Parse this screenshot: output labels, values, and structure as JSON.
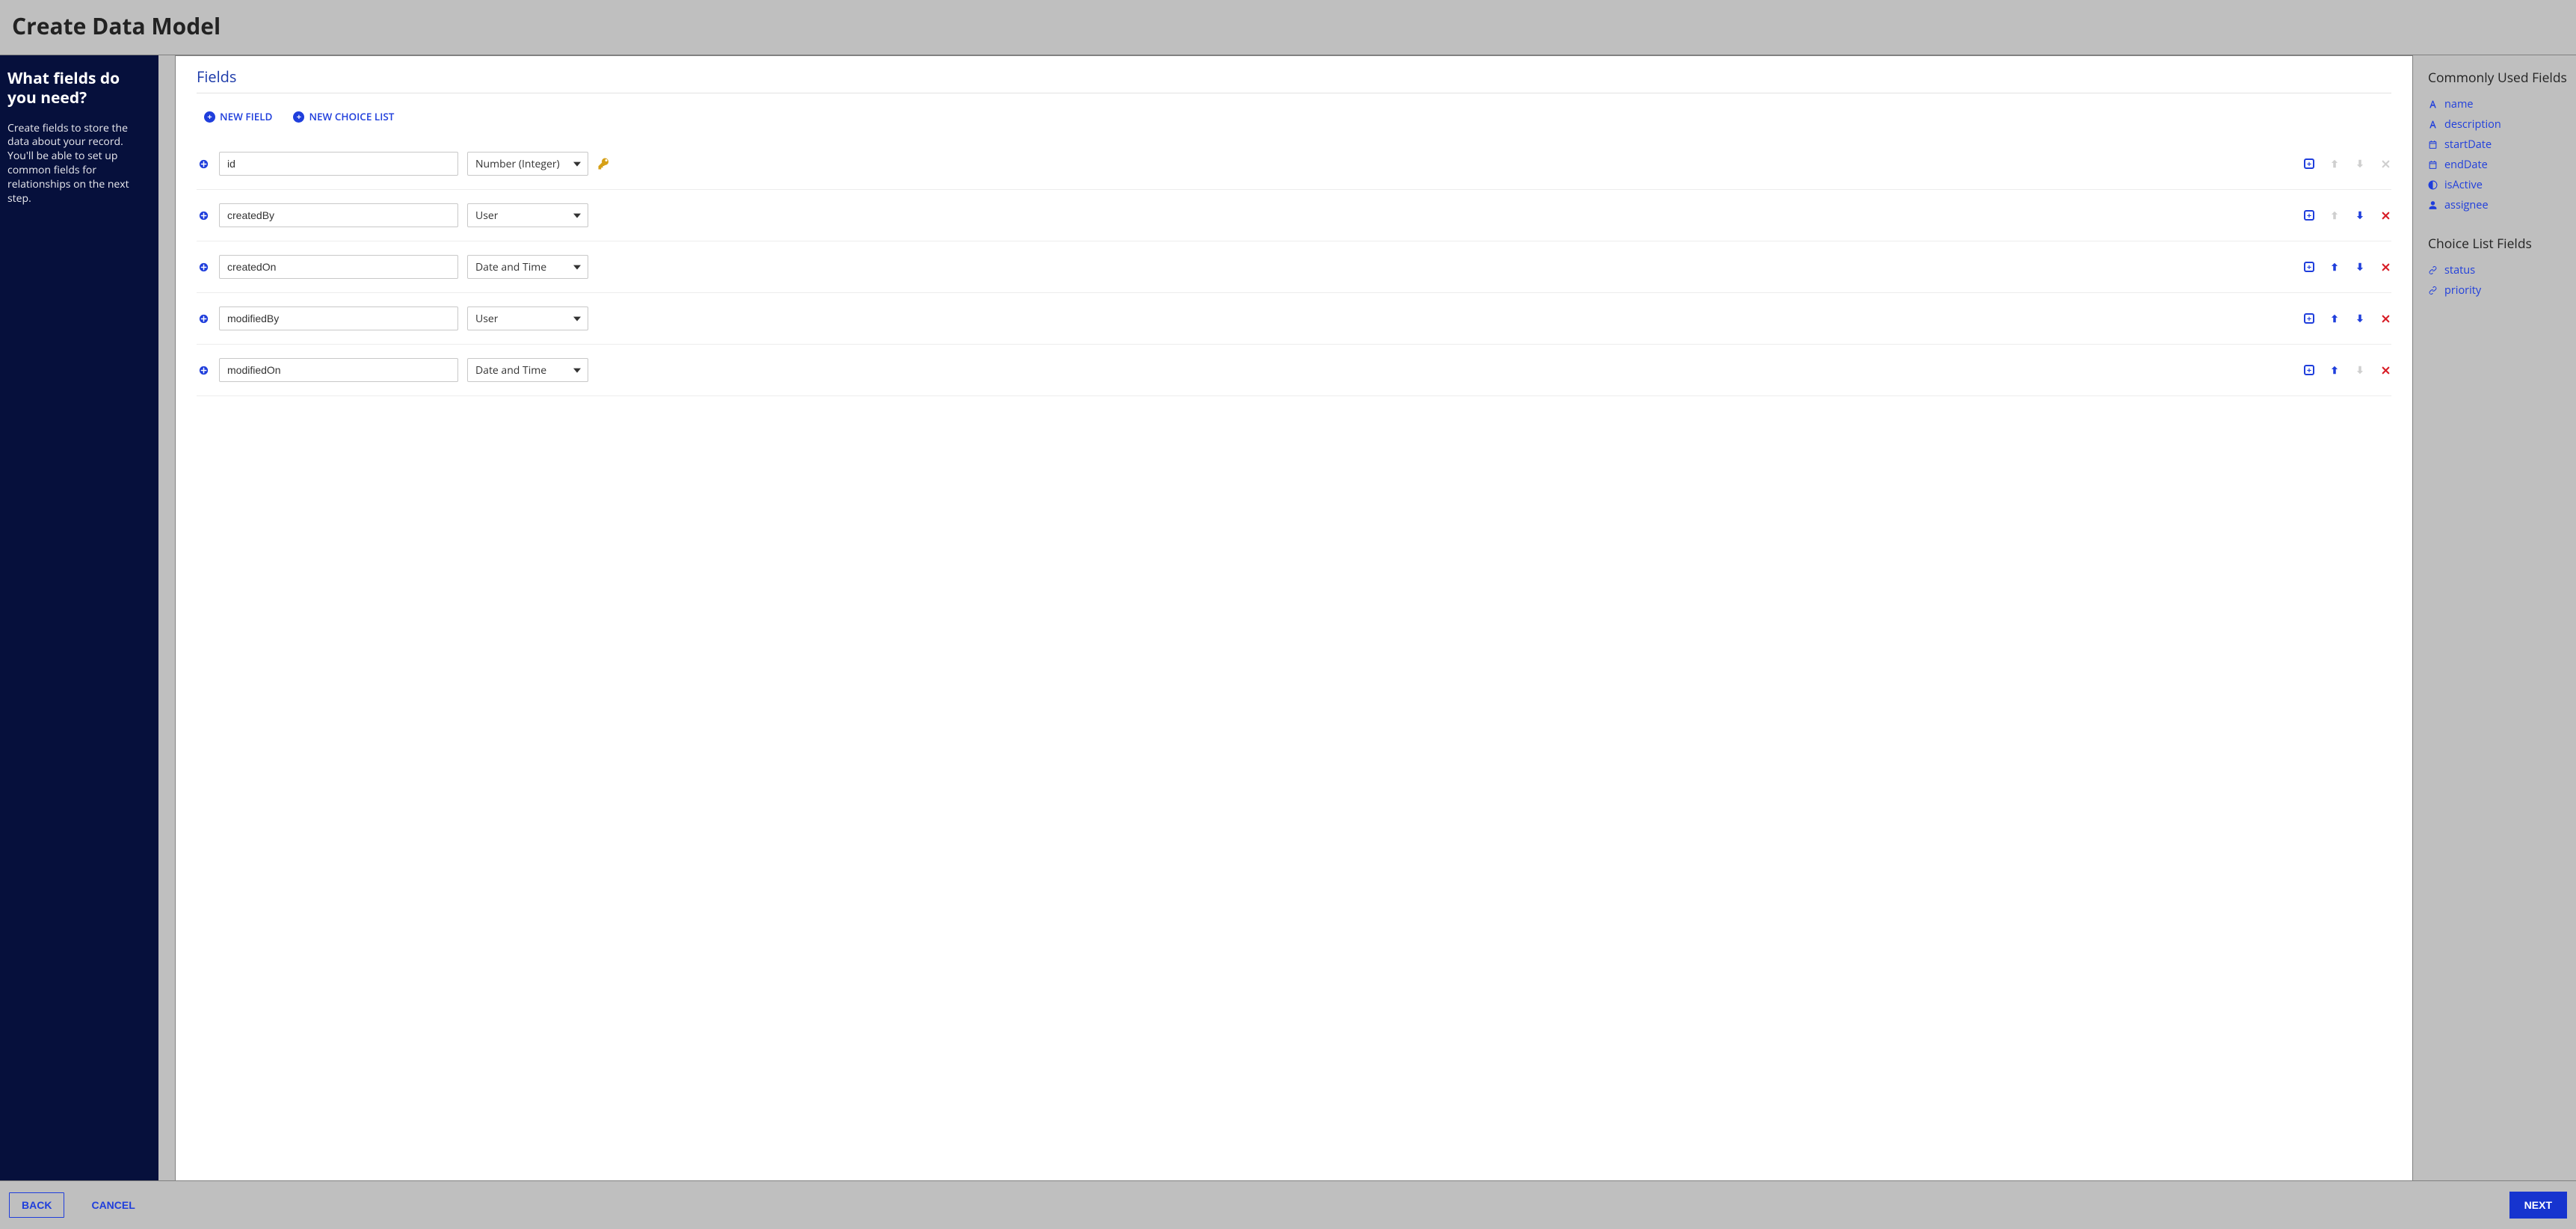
{
  "header": {
    "title": "Create Data Model"
  },
  "sidebar": {
    "question": "What fields do you need?",
    "description": "Create fields to store the data about your record. You'll be able to set up common fields for relationships on the next step."
  },
  "panel": {
    "section_title": "Fields",
    "new_field_label": "NEW FIELD",
    "new_choice_list_label": "NEW CHOICE LIST"
  },
  "fields": [
    {
      "name": "id",
      "type": "Number (Integer)",
      "is_key": true,
      "actions": {
        "add": true,
        "up": false,
        "down": false,
        "remove": false
      }
    },
    {
      "name": "createdBy",
      "type": "User",
      "is_key": false,
      "actions": {
        "add": true,
        "up": false,
        "down": true,
        "remove": true
      }
    },
    {
      "name": "createdOn",
      "type": "Date and Time",
      "is_key": false,
      "actions": {
        "add": true,
        "up": true,
        "down": true,
        "remove": true
      }
    },
    {
      "name": "modifiedBy",
      "type": "User",
      "is_key": false,
      "actions": {
        "add": true,
        "up": true,
        "down": true,
        "remove": true
      }
    },
    {
      "name": "modifiedOn",
      "type": "Date and Time",
      "is_key": false,
      "actions": {
        "add": true,
        "up": true,
        "down": false,
        "remove": true
      }
    }
  ],
  "common_fields": {
    "heading": "Commonly Used Fields",
    "items": [
      {
        "icon": "font",
        "label": "name"
      },
      {
        "icon": "font",
        "label": "description"
      },
      {
        "icon": "calendar",
        "label": "startDate"
      },
      {
        "icon": "calendar",
        "label": "endDate"
      },
      {
        "icon": "halfpie",
        "label": "isActive"
      },
      {
        "icon": "user",
        "label": "assignee"
      }
    ]
  },
  "choice_fields": {
    "heading": "Choice List Fields",
    "items": [
      {
        "icon": "link",
        "label": "status"
      },
      {
        "icon": "link",
        "label": "priority"
      }
    ]
  },
  "footer": {
    "back_label": "BACK",
    "cancel_label": "CANCEL",
    "next_label": "NEXT"
  }
}
